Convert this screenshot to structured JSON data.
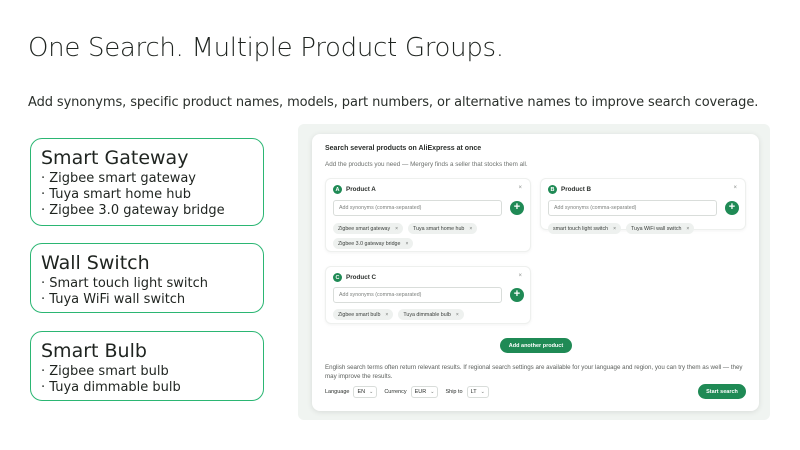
{
  "slide": {
    "title": "One Search. Multiple Product Groups.",
    "subtitle": "Add synonyms, specific product names, models, part numbers, or alternative names to improve search coverage."
  },
  "groups": [
    {
      "title": "Smart Gateway",
      "items": [
        "· Zigbee smart gateway",
        "· Tuya smart home hub",
        "· Zigbee 3.0 gateway bridge"
      ]
    },
    {
      "title": "Wall Switch",
      "items": [
        "· Smart touch light switch",
        "· Tuya WiFi wall switch"
      ]
    },
    {
      "title": "Smart Bulb",
      "items": [
        "· Zigbee smart bulb",
        "· Tuya dimmable bulb"
      ]
    }
  ],
  "panel": {
    "heading": "Search several products on AliExpress at once",
    "subheading": "Add the products you need — Mergery finds a seller that stocks them all.",
    "products": [
      {
        "badge": "A",
        "name": "Product A",
        "placeholder": "Add synonyms (comma-separated)",
        "chips": [
          "Zigbee smart gateway",
          "Tuya smart home hub",
          "Zigbee 3.0 gateway bridge"
        ]
      },
      {
        "badge": "B",
        "name": "Product B",
        "placeholder": "Add synonyms (comma-separated)",
        "chips": [
          "smart touch light switch",
          "Tuya WiFi wall switch"
        ]
      },
      {
        "badge": "C",
        "name": "Product C",
        "placeholder": "Add synonyms (comma-separated)",
        "chips": [
          "Zigbee smart bulb",
          "Tuya dimmable bulb"
        ]
      }
    ],
    "close_glyph": "×",
    "add_glyph": "+",
    "chip_remove_glyph": "×",
    "add_another_label": "Add another product",
    "note": "English search terms often return relevant results. If regional search settings are available for your language and region, you can try them as well — they may improve the results.",
    "settings": {
      "language_label": "Language",
      "language_value": "EN",
      "currency_label": "Currency",
      "currency_value": "EUR",
      "shipto_label": "Ship to",
      "shipto_value": "LT"
    },
    "start_label": "Start search"
  },
  "colors": {
    "accent": "#1f8a55",
    "card_border": "#2bb673"
  }
}
